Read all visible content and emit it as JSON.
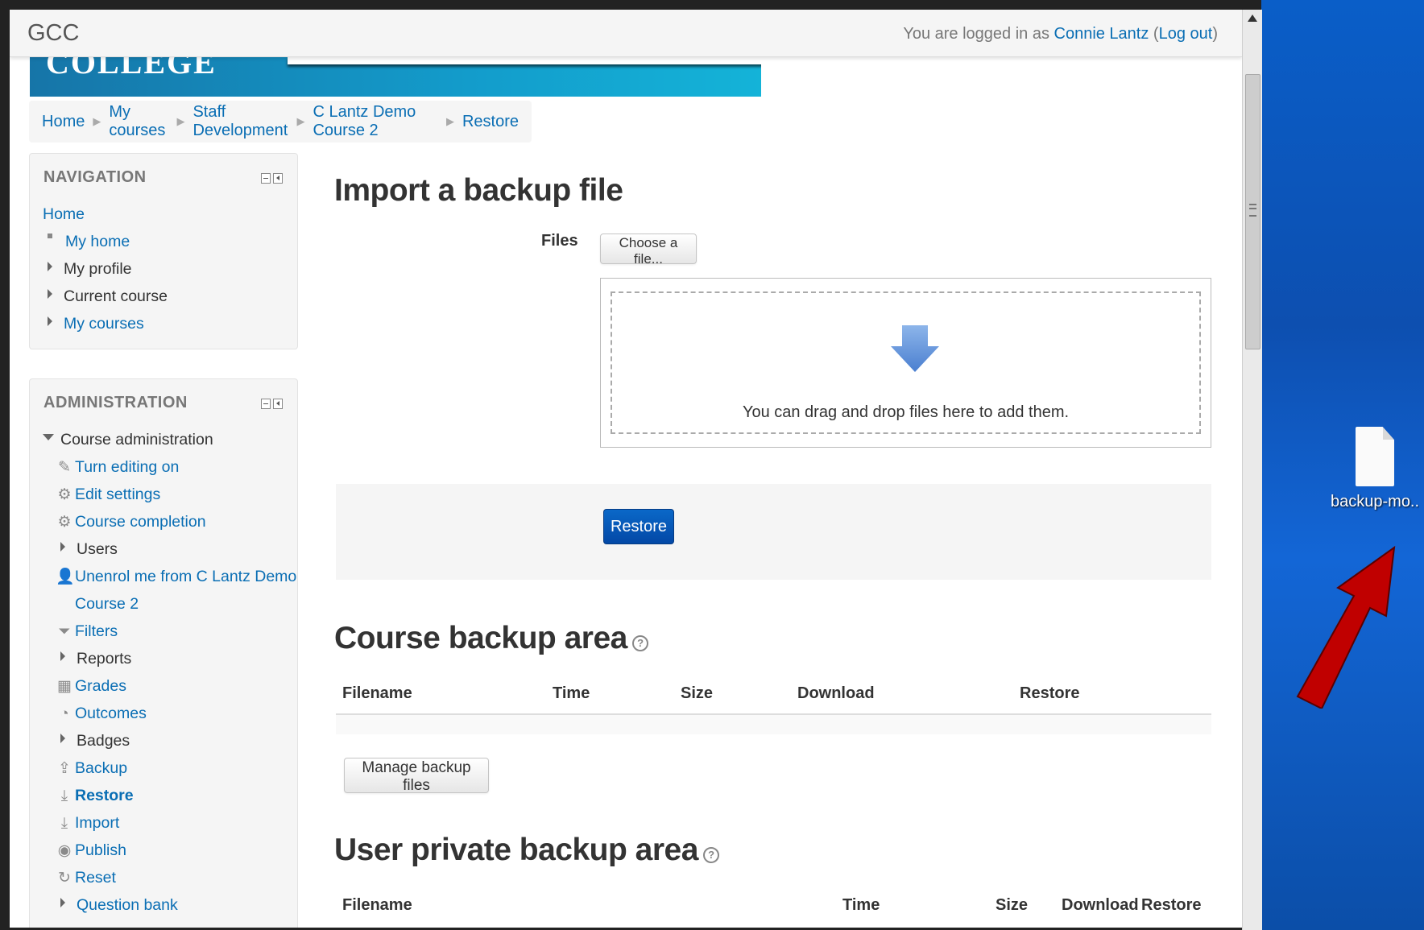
{
  "navbar": {
    "brand": "GCC",
    "login_prefix": "You are logged in as ",
    "user_name": "Connie Lantz",
    "logout_label": "Log out"
  },
  "banner": {
    "text": "COLLEGE"
  },
  "breadcrumb": [
    "Home",
    "My courses",
    "Staff Development",
    "C Lantz Demo Course 2",
    "Restore"
  ],
  "navigation": {
    "title": "NAVIGATION",
    "home": "Home",
    "items": [
      "My home",
      "My profile",
      "Current course",
      "My courses"
    ]
  },
  "administration": {
    "title": "ADMINISTRATION",
    "section": "Course administration",
    "items": [
      "Turn editing on",
      "Edit settings",
      "Course completion",
      "Users",
      "Unenrol me from C Lantz Demo",
      "Course 2",
      "Filters",
      "Reports",
      "Grades",
      "Outcomes",
      "Badges",
      "Backup",
      "Restore",
      "Import",
      "Publish",
      "Reset",
      "Question bank"
    ]
  },
  "import": {
    "heading": "Import a backup file",
    "files_label": "Files",
    "choose_button": "Choose a file...",
    "drop_text": "You can drag and drop files here to add them.",
    "restore_button": "Restore"
  },
  "course_backup": {
    "heading": "Course backup area",
    "columns": [
      "Filename",
      "Time",
      "Size",
      "Download",
      "Restore"
    ],
    "manage_button": "Manage backup files"
  },
  "user_backup": {
    "heading": "User private backup area",
    "columns": [
      "Filename",
      "Time",
      "Size",
      "Download",
      "Restore"
    ]
  },
  "desktop": {
    "file_label": "backup-mo..."
  },
  "colors": {
    "link": "#0a6eb4",
    "primary": "#0348a6",
    "desktop": "#0d4fb0",
    "arrow": "#c00000"
  }
}
